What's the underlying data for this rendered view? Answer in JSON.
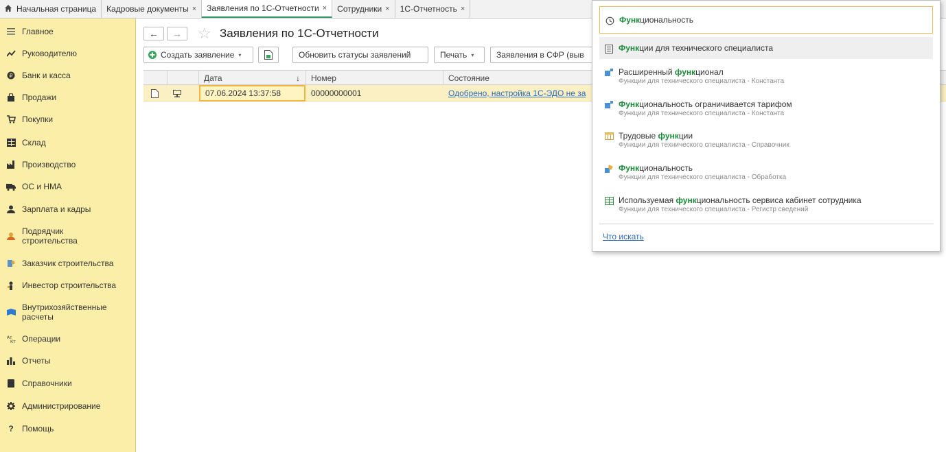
{
  "tabs": [
    {
      "label": "Начальная страница",
      "closable": false
    },
    {
      "label": "Кадровые документы",
      "closable": true
    },
    {
      "label": "Заявления по 1С-Отчетности",
      "closable": true,
      "active": true
    },
    {
      "label": "Сотрудники",
      "closable": true
    },
    {
      "label": "1С-Отчетность",
      "closable": true
    }
  ],
  "tab_close_glyph": "×",
  "sidebar": {
    "items": [
      {
        "label": "Главное",
        "icon": "menu-lines-icon"
      },
      {
        "label": "Руководителю",
        "icon": "trend-chart-icon"
      },
      {
        "label": "Банк и касса",
        "icon": "coin-icon"
      },
      {
        "label": "Продажи",
        "icon": "shopping-bag-icon"
      },
      {
        "label": "Покупки",
        "icon": "cart-icon"
      },
      {
        "label": "Склад",
        "icon": "warehouse-icon"
      },
      {
        "label": "Производство",
        "icon": "factory-icon"
      },
      {
        "label": "ОС и НМА",
        "icon": "truck-icon"
      },
      {
        "label": "Зарплата и кадры",
        "icon": "person-icon"
      },
      {
        "label": "Подрядчик строительства",
        "icon": "builder-icon"
      },
      {
        "label": "Заказчик строительства",
        "icon": "customer-icon"
      },
      {
        "label": "Инвестор строительства",
        "icon": "investor-icon"
      },
      {
        "label": "Внутрихозяйственные расчеты",
        "icon": "folder-blue-icon"
      },
      {
        "label": "Операции",
        "icon": "accounting-icon"
      },
      {
        "label": "Отчеты",
        "icon": "bar-chart-icon"
      },
      {
        "label": "Справочники",
        "icon": "book-icon"
      },
      {
        "label": "Администрирование",
        "icon": "gear-icon"
      },
      {
        "label": "Помощь",
        "icon": "question-icon"
      }
    ]
  },
  "page": {
    "title": "Заявления по 1С-Отчетности",
    "back_glyph": "←",
    "forward_glyph": "→",
    "star_glyph": "☆"
  },
  "toolbar": {
    "create_label": "Создать заявление",
    "refresh_label": "Обновить статусы заявлений",
    "print_label": "Печать",
    "sfr_label": "Заявления в СФР (выв"
  },
  "table": {
    "headers": {
      "date": "Дата",
      "sort": "↓",
      "number": "Номер",
      "state": "Состояние"
    },
    "rows": [
      {
        "date": "07.06.2024 13:37:58",
        "number": "00000000001",
        "state": "Одобрено, настройка 1С-ЭДО не за"
      }
    ]
  },
  "search_popup": {
    "first": {
      "bold": "Функ",
      "rest": "циональность"
    },
    "second": {
      "bold": "Функ",
      "rest": "ции для технического специалиста"
    },
    "results": [
      {
        "pre": "Расширенный ",
        "bold": "функ",
        "post": "ционал",
        "sub": "Функции для технического специалиста - Константа",
        "icon": "constant-icon"
      },
      {
        "pre": "",
        "bold": "Функ",
        "post": "циональность ограничивается тарифом",
        "sub": "Функции для технического специалиста - Константа",
        "icon": "constant-icon"
      },
      {
        "pre": "Трудовые ",
        "bold": "функ",
        "post": "ции",
        "sub": "Функции для технического специалиста - Справочник",
        "icon": "catalog-icon"
      },
      {
        "pre": "",
        "bold": "Функ",
        "post": "циональность",
        "sub": "Функции для технического специалиста - Обработка",
        "icon": "processing-icon"
      },
      {
        "pre": "Используемая ",
        "bold": "функ",
        "post": "циональность сервиса кабинет сотрудника",
        "sub": "Функции для технического специалиста - Регистр сведений",
        "icon": "register-icon"
      }
    ],
    "what_to_search": "Что искать"
  },
  "colors": {
    "sidebar_bg": "#fbeea9",
    "accent_green": "#1e8a3c",
    "selected_row": "#fbf0c4",
    "link": "#2e6bb8"
  }
}
